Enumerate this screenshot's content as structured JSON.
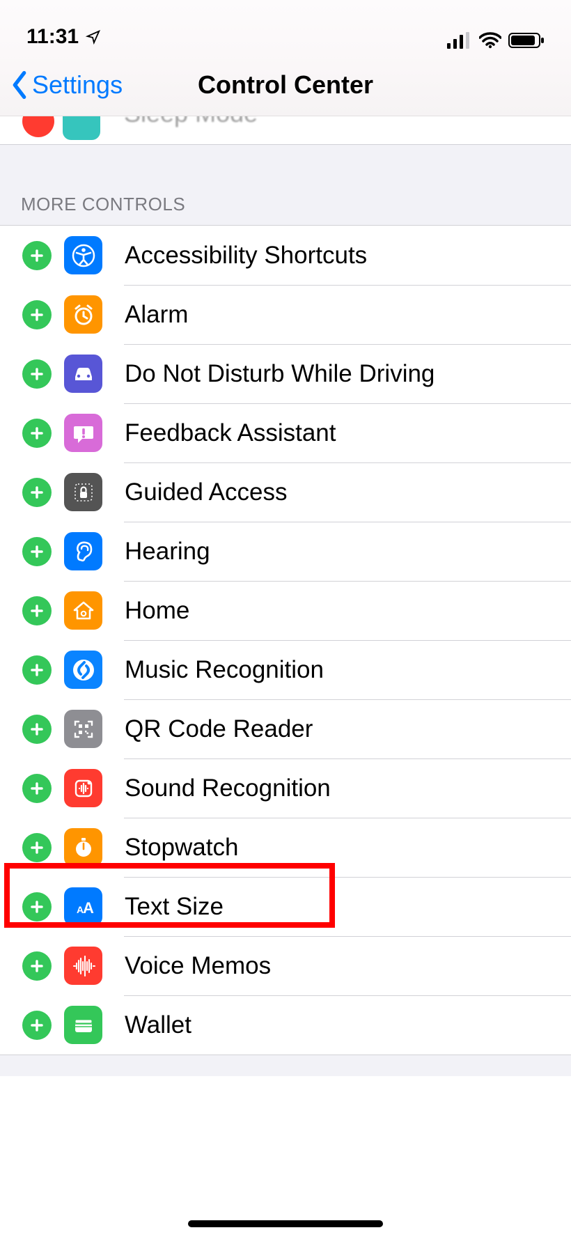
{
  "status": {
    "time": "11:31",
    "location_icon": "location-arrow-icon",
    "signal_icon": "cellular-signal-icon",
    "wifi_icon": "wifi-icon",
    "battery_icon": "battery-icon"
  },
  "nav": {
    "back_label": "Settings",
    "title": "Control Center"
  },
  "partial_row": {
    "label": "Sleep Mode"
  },
  "section_header": "MORE CONTROLS",
  "highlight_index": 7,
  "controls": [
    {
      "label": "Accessibility Shortcuts",
      "icon": "accessibility-icon",
      "bg": "#007aff"
    },
    {
      "label": "Alarm",
      "icon": "alarm-clock-icon",
      "bg": "#ff9500"
    },
    {
      "label": "Do Not Disturb While Driving",
      "icon": "car-icon",
      "bg": "#5856d6"
    },
    {
      "label": "Feedback Assistant",
      "icon": "feedback-bubble-icon",
      "bg": "#d86bd8"
    },
    {
      "label": "Guided Access",
      "icon": "guided-access-lock-icon",
      "bg": "#545454"
    },
    {
      "label": "Hearing",
      "icon": "ear-icon",
      "bg": "#007aff"
    },
    {
      "label": "Home",
      "icon": "home-icon",
      "bg": "#ff9500"
    },
    {
      "label": "Music Recognition",
      "icon": "shazam-icon",
      "bg": "#0a84ff"
    },
    {
      "label": "QR Code Reader",
      "icon": "qr-code-icon",
      "bg": "#8e8e93"
    },
    {
      "label": "Sound Recognition",
      "icon": "sound-recognition-icon",
      "bg": "#ff3b30"
    },
    {
      "label": "Stopwatch",
      "icon": "stopwatch-icon",
      "bg": "#ff9500"
    },
    {
      "label": "Text Size",
      "icon": "text-size-icon",
      "bg": "#007aff"
    },
    {
      "label": "Voice Memos",
      "icon": "waveform-icon",
      "bg": "#ff3b30"
    },
    {
      "label": "Wallet",
      "icon": "wallet-icon",
      "bg": "#34c759"
    }
  ]
}
